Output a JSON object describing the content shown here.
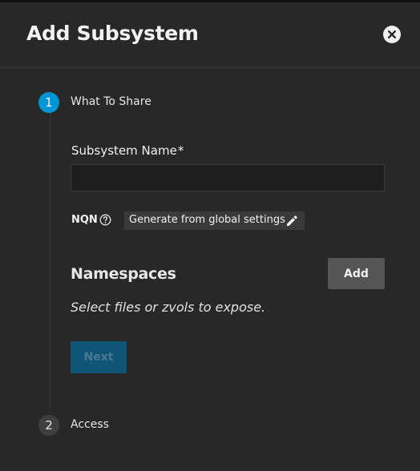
{
  "dialog": {
    "title": "Add Subsystem",
    "close_icon": "close-circle-icon"
  },
  "stepper": {
    "steps": [
      {
        "number": "1",
        "label": "What To Share",
        "active": true,
        "color": "#0095d5"
      },
      {
        "number": "2",
        "label": "Access",
        "active": false
      }
    ]
  },
  "form": {
    "subsystem_name": {
      "label": "Subsystem Name",
      "required_marker": "*",
      "value": "",
      "placeholder": ""
    },
    "nqn": {
      "label": "NQN",
      "help_icon": "help-circle-icon",
      "chip_label": "Generate from global settings",
      "edit_icon": "pencil-icon"
    },
    "namespaces": {
      "title": "Namespaces",
      "add_label": "Add",
      "empty_text": "Select files or zvols to expose."
    },
    "next_label": "Next"
  }
}
